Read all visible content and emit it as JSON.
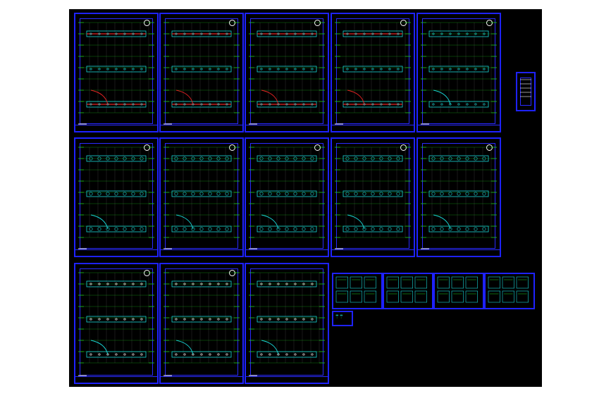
{
  "window": {
    "title": ""
  },
  "drawing": {
    "background": "#000000",
    "frame_color": "#1e22ff",
    "axis_color": "#1fd31f",
    "wall_color": "#19d6d6",
    "highlight_color": "#e82424",
    "text_color": "#ffffff"
  },
  "sheets": {
    "row1": [
      "sheet-1",
      "sheet-2",
      "sheet-3",
      "sheet-4",
      "sheet-5"
    ],
    "row2": [
      "sheet-6",
      "sheet-7",
      "sheet-8",
      "sheet-9",
      "sheet-10"
    ],
    "row3": [
      "sheet-11",
      "sheet-12",
      "sheet-13"
    ]
  },
  "details": [
    "detail-1",
    "detail-2",
    "detail-3",
    "detail-4",
    "detail-5"
  ],
  "icons": {
    "north_arrow": "north-arrow-icon"
  }
}
